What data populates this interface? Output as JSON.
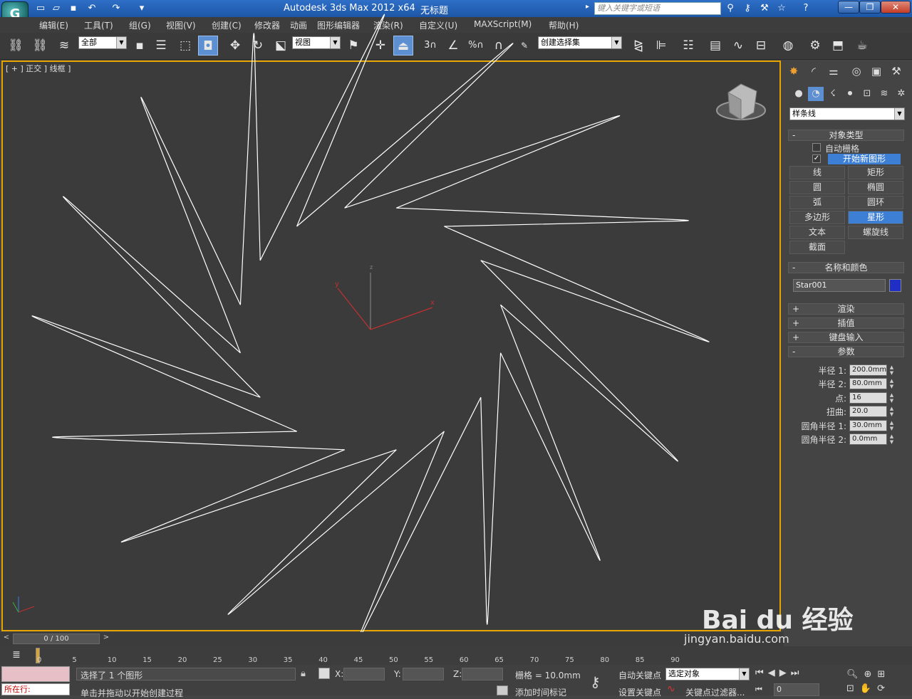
{
  "titlebar": {
    "logo": "G",
    "app_title": "Autodesk 3ds Max  2012 x64",
    "doc_title": "无标题",
    "search_placeholder": "键入关键字或短语",
    "minimize": "—",
    "restore": "❐",
    "close": "✕"
  },
  "menu": [
    "编辑(E)",
    "工具(T)",
    "组(G)",
    "视图(V)",
    "创建(C)",
    "修改器",
    "动画",
    "图形编辑器",
    "渲染(R)",
    "自定义(U)",
    "MAXScript(M)",
    "帮助(H)"
  ],
  "toolbar": {
    "selection_filter": "全部",
    "ref_coord": "视图",
    "named_selection": "创建选择集",
    "snap_label": "3"
  },
  "viewport": {
    "label": "[ + ] 正交 ] 线框 ]",
    "axis_x": "x",
    "axis_y": "y",
    "axis_z": "z"
  },
  "command_panel": {
    "category_dropdown": "样条线",
    "object_type": {
      "title": "对象类型",
      "autogrid": "自动栅格",
      "start_new_shape": "开始新图形",
      "buttons": [
        "线",
        "矩形",
        "圆",
        "椭圆",
        "弧",
        "圆环",
        "多边形",
        "星形",
        "文本",
        "螺旋线",
        "截面"
      ],
      "selected": "星形"
    },
    "name_color": {
      "title": "名称和颜色",
      "name": "Star001",
      "color": "#1f2ec4"
    },
    "collapsed": [
      "渲染",
      "插值",
      "键盘输入"
    ],
    "parameters": {
      "title": "参数",
      "rows": [
        {
          "label": "半径 1:",
          "value": "200.0mm"
        },
        {
          "label": "半径 2:",
          "value": "80.0mm"
        },
        {
          "label": "点:",
          "value": "16"
        },
        {
          "label": "扭曲:",
          "value": "20.0"
        },
        {
          "label": "圆角半径 1:",
          "value": "30.0mm"
        },
        {
          "label": "圆角半径 2:",
          "value": "0.0mm"
        }
      ]
    }
  },
  "timeline": {
    "frame_display": "0 / 100",
    "prev": "<",
    "next": ">",
    "ticks": [
      "0",
      "5",
      "10",
      "15",
      "20",
      "25",
      "30",
      "35",
      "40",
      "45",
      "50",
      "55",
      "60",
      "65",
      "70",
      "75",
      "80",
      "85",
      "90"
    ]
  },
  "status": {
    "mode": "所在行:",
    "selection_info": "选择了 1 个图形",
    "prompt": "单击并拖动以开始创建过程",
    "x_label": "X:",
    "y_label": "Y:",
    "z_label": "Z:",
    "grid": "栅格 = 10.0mm",
    "add_time_tag": "添加时间标记",
    "auto_key": "自动关键点",
    "set_key": "设置关键点",
    "key_mode": "选定对象",
    "key_filters": "关键点过滤器...",
    "frame_value": "0"
  },
  "watermark": {
    "brand": "Bai du 经验",
    "url": "jingyan.baidu.com"
  }
}
